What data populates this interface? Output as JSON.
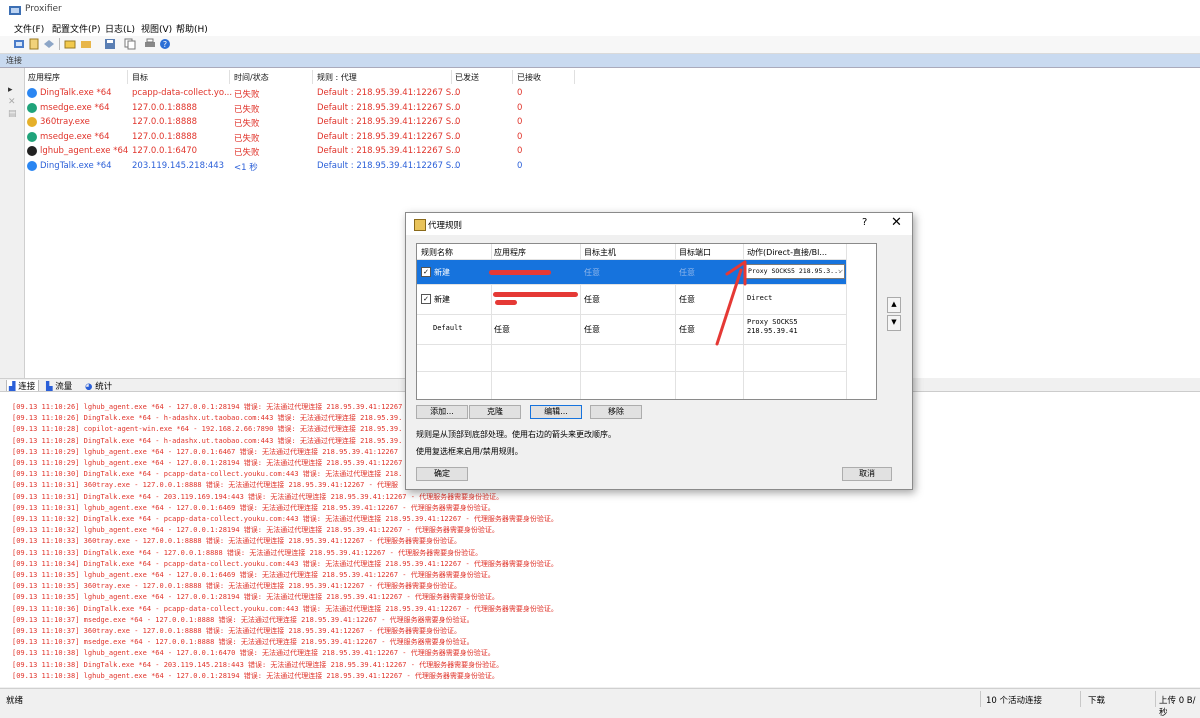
{
  "window": {
    "title": "Proxifier"
  },
  "menu": [
    "文件(F)",
    "配置文件(P)",
    "日志(L)",
    "视图(V)",
    "帮助(H)"
  ],
  "toolbar": {
    "icons": [
      "connections-icon",
      "profile-icon",
      "rules-icon",
      "open-icon",
      "folder-icon",
      "save-icon",
      "copy-icon",
      "print-icon",
      "help-icon"
    ]
  },
  "connections": {
    "header": "连接",
    "columns": [
      "应用程序",
      "目标",
      "时间/状态",
      "规则 : 代理",
      "已发送",
      "已接收"
    ],
    "rows": [
      {
        "app": "DingTalk.exe *64",
        "target": "pcapp-data-collect.yo...",
        "status": "已失败",
        "rule": "Default : 218.95.39.41:12267 S...",
        "sent": "0",
        "recv": "0",
        "color": "red",
        "icon": "dingtalk-icon"
      },
      {
        "app": "msedge.exe *64",
        "target": "127.0.0.1:8888",
        "status": "已失败",
        "rule": "Default : 218.95.39.41:12267 S...",
        "sent": "0",
        "recv": "0",
        "color": "red",
        "icon": "edge-icon"
      },
      {
        "app": "360tray.exe",
        "target": "127.0.0.1:8888",
        "status": "已失败",
        "rule": "Default : 218.95.39.41:12267 S...",
        "sent": "0",
        "recv": "0",
        "color": "red",
        "icon": "360-icon"
      },
      {
        "app": "msedge.exe *64",
        "target": "127.0.0.1:8888",
        "status": "已失败",
        "rule": "Default : 218.95.39.41:12267 S...",
        "sent": "0",
        "recv": "0",
        "color": "red",
        "icon": "edge-icon"
      },
      {
        "app": "lghub_agent.exe *64",
        "target": "127.0.0.1:6470",
        "status": "已失败",
        "rule": "Default : 218.95.39.41:12267 S...",
        "sent": "0",
        "recv": "0",
        "color": "red",
        "icon": "lghub-icon"
      },
      {
        "app": "DingTalk.exe *64",
        "target": "203.119.145.218:443",
        "status": "<1 秒",
        "rule": "Default : 218.95.39.41:12267 S...",
        "sent": "0",
        "recv": "0",
        "color": "blue",
        "icon": "dingtalk-icon"
      }
    ]
  },
  "tabs": [
    "连接",
    "流量",
    "统计"
  ],
  "log_lines": [
    "[09.13 11:10:26] lghub_agent.exe *64 - 127.0.0.1:28194 错误: 无法通过代理连接 218.95.39.41:12267",
    "[09.13 11:10:26] DingTalk.exe *64 - h-adashx.ut.taobao.com:443 错误: 无法通过代理连接 218.95.39.",
    "[09.13 11:10:28] copilot-agent-win.exe *64 - 192.168.2.66:7890 错误: 无法通过代理连接 218.95.39.",
    "[09.13 11:10:28] DingTalk.exe *64 - h-adashx.ut.taobao.com:443 错误: 无法通过代理连接 218.95.39.",
    "[09.13 11:10:29] lghub_agent.exe *64 - 127.0.0.1:6467 错误: 无法通过代理连接 218.95.39.41:12267",
    "[09.13 11:10:29] lghub_agent.exe *64 - 127.0.0.1:28194 错误: 无法通过代理连接 218.95.39.41:12267",
    "[09.13 11:10:30] DingTalk.exe *64 - pcapp-data-collect.youku.com:443 错误: 无法通过代理连接 218.",
    "[09.13 11:10:31] 360tray.exe - 127.0.0.1:8888 错误: 无法通过代理连接 218.95.39.41:12267 - 代理服",
    "[09.13 11:10:31] DingTalk.exe *64 - 203.119.169.194:443 错误: 无法通过代理连接 218.95.39.41:12267 - 代理服务器需要身份验证。",
    "[09.13 11:10:31] lghub_agent.exe *64 - 127.0.0.1:6469 错误: 无法通过代理连接 218.95.39.41:12267 - 代理服务器需要身份验证。",
    "[09.13 11:10:32] DingTalk.exe *64 - pcapp-data-collect.youku.com:443 错误: 无法通过代理连接 218.95.39.41:12267 - 代理服务器需要身份验证。",
    "[09.13 11:10:32] lghub_agent.exe *64 - 127.0.0.1:28194 错误: 无法通过代理连接 218.95.39.41:12267 - 代理服务器需要身份验证。",
    "[09.13 11:10:33] 360tray.exe - 127.0.0.1:8888 错误: 无法通过代理连接 218.95.39.41:12267 - 代理服务器需要身份验证。",
    "[09.13 11:10:33] DingTalk.exe *64 - 127.0.0.1:8888 错误: 无法通过代理连接 218.95.39.41:12267 - 代理服务器需要身份验证。",
    "[09.13 11:10:34] DingTalk.exe *64 - pcapp-data-collect.youku.com:443 错误: 无法通过代理连接 218.95.39.41:12267 - 代理服务器需要身份验证。",
    "[09.13 11:10:35] lghub_agent.exe *64 - 127.0.0.1:6469 错误: 无法通过代理连接 218.95.39.41:12267 - 代理服务器需要身份验证。",
    "[09.13 11:10:35] 360tray.exe - 127.0.0.1:8888 错误: 无法通过代理连接 218.95.39.41:12267 - 代理服务器需要身份验证。",
    "[09.13 11:10:35] lghub_agent.exe *64 - 127.0.0.1:28194 错误: 无法通过代理连接 218.95.39.41:12267 - 代理服务器需要身份验证。",
    "[09.13 11:10:36] DingTalk.exe *64 - pcapp-data-collect.youku.com:443 错误: 无法通过代理连接 218.95.39.41:12267 - 代理服务器需要身份验证。",
    "[09.13 11:10:37] msedge.exe *64 - 127.0.0.1:8888 错误: 无法通过代理连接 218.95.39.41:12267 - 代理服务器需要身份验证。",
    "[09.13 11:10:37] 360tray.exe - 127.0.0.1:8888 错误: 无法通过代理连接 218.95.39.41:12267 - 代理服务器需要身份验证。",
    "[09.13 11:10:37] msedge.exe *64 - 127.0.0.1:8888 错误: 无法通过代理连接 218.95.39.41:12267 - 代理服务器需要身份验证。",
    "[09.13 11:10:38] lghub_agent.exe *64 - 127.0.0.1:6470 错误: 无法通过代理连接 218.95.39.41:12267 - 代理服务器需要身份验证。",
    "[09.13 11:10:38] DingTalk.exe *64 - 203.119.145.218:443 错误: 无法通过代理连接 218.95.39.41:12267 - 代理服务器需要身份验证。",
    "[09.13 11:10:38] lghub_agent.exe *64 - 127.0.0.1:28194 错误: 无法通过代理连接 218.95.39.41:12267 - 代理服务器需要身份验证。"
  ],
  "status_bar": {
    "ready": "就绪",
    "active": "10 个活动连接",
    "down": "下载",
    "up": "上传 0 B/秒"
  },
  "dialog": {
    "title": "代理规则",
    "help": "?",
    "close": "✕",
    "columns": [
      "规则名称",
      "应用程序",
      "目标主机",
      "目标端口",
      "动作(Direct-直接/Bl..."
    ],
    "rules": [
      {
        "name": "新建",
        "app": "",
        "host": "任意",
        "port": "任意",
        "action": "Proxy SOCKS5 218.95.3...",
        "checked": true,
        "selected": true
      },
      {
        "name": "新建",
        "app": "",
        "host": "任意",
        "port": "任意",
        "action": "Direct",
        "checked": true,
        "selected": false
      },
      {
        "name": "Default",
        "app": "任意",
        "host": "任意",
        "port": "任意",
        "action": "Proxy SOCKS5",
        "action2": "218.95.39.41",
        "checked": false,
        "selected": false
      }
    ],
    "buttons": {
      "add": "添加...",
      "clone": "克隆",
      "edit": "编辑...",
      "remove": "移除",
      "ok": "确定",
      "cancel": "取消"
    },
    "hint1": "规则是从顶部到底部处理。使用右边的箭头来更改顺序。",
    "hint2": "使用复选框来启用/禁用规则。",
    "accent": "#1673dd"
  }
}
